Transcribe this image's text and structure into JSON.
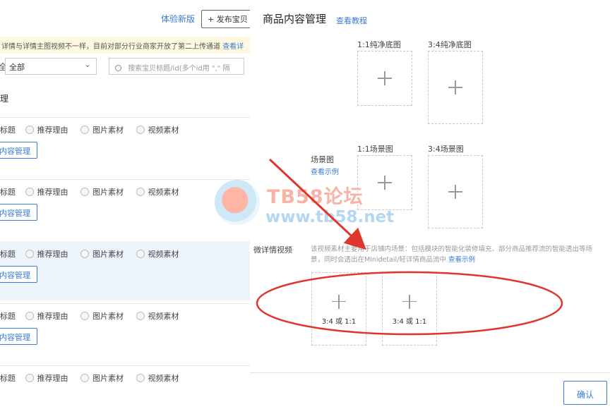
{
  "background": {
    "experience_link": "体验新版",
    "publish_button": "发布宝贝",
    "notice_text": "详情与详情主图视频不一样，目前对部分行业商家开放了第二上传通道",
    "notice_link": "查看详",
    "filter_label": "全",
    "filter_value": "全部",
    "search_placeholder": "搜索宝贝标题/id(多个id用 \",\" 隔",
    "column_header": "理",
    "row_options": [
      "标题",
      "推荐理由",
      "图片素材",
      "视频素材"
    ],
    "row_button": "内容管理",
    "rows": [
      {
        "button": "内容管理"
      },
      {
        "button": "内容管理"
      },
      {
        "button": "内容管理"
      },
      {
        "button": "内容管理"
      },
      {
        "button": ""
      }
    ]
  },
  "panel": {
    "title": "商品内容管理",
    "help_link": "查看教程",
    "white_bg": {
      "square_label": "1:1纯净底图",
      "portrait_label": "3:4纯净底图"
    },
    "scene": {
      "label": "场景图",
      "example_link": "查看示例",
      "square_label": "1:1场景图",
      "portrait_label": "3:4场景图"
    },
    "video": {
      "label": "微详情视频",
      "description": "该视频素材主要用于店铺内场景：包括模块的智能化装修填充、部分商品推荐流的智能透出等场景，同时会透出在Minidetail/轻详情商品流中",
      "example_link": "查看示例",
      "upload_hints": [
        "3:4 或 1:1",
        "3:4 或 1:1"
      ]
    },
    "confirm_button": "确认"
  },
  "watermark": {
    "title": "TB58论坛",
    "url": "www.tb58.net"
  },
  "colors": {
    "accent": "#3a7bd5",
    "annotation": "#e0352b",
    "notice_bg": "#fff8e0",
    "highlight_row": "#eef4fb"
  }
}
